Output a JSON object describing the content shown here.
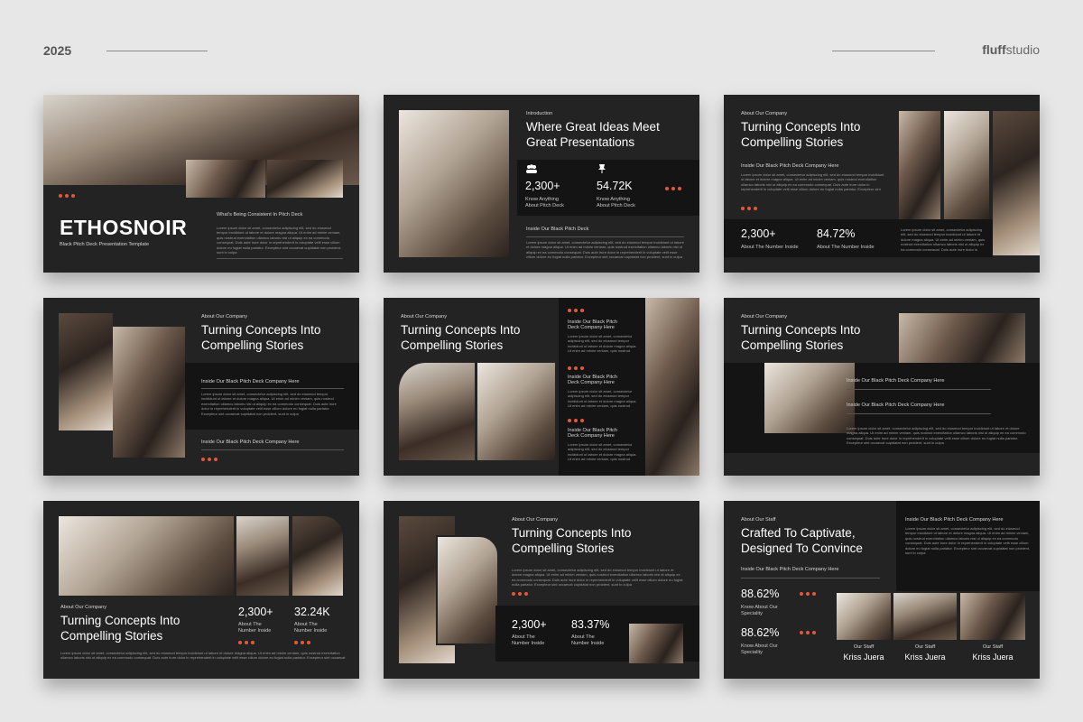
{
  "header": {
    "year": "2025",
    "brand_bold": "fluff",
    "brand_rest": "studio"
  },
  "lorem": "Lorem ipsum dolor sit amet, consectetur adipiscing elit, sed do eiusmod tempor incididunt ut labore et dolore magna aliqua. Ut enim ad minim veniam, quis nostrud exercitation ullamco laboris nisi ut aliquip ex ea commodo consequat. Duis aute irure dolor in reprehenderit in voluptate velit esse cillum dolore eu fugiat nulla pariatur. Excepteur sint occaecat cupidatat non proident, sunt in culpa",
  "s1": {
    "brand": "ETHOSNOIR",
    "subtitle": "Black Pitch Deck Presentation Template",
    "heading": "What's Being Consistent In Pitch Deck"
  },
  "s2": {
    "kicker": "Introduction",
    "title_1": "Where Great Ideas Meet",
    "title_2": "Great Presentations",
    "stat1_num": "2,300+",
    "stat1_l1": "Know Anything",
    "stat1_l2": "About Pitch Deck",
    "stat2_num": "54.72K",
    "stat2_l1": "Know Anything",
    "stat2_l2": "About Pitch Deck",
    "sub": "Inside Our Black Pitch Deck",
    "icon1": "users-icon",
    "icon2": "pin-icon"
  },
  "s3": {
    "kicker": "About Our Company",
    "title_1": "Turning Concepts Into",
    "title_2": "Compelling Stories",
    "sub": "Inside Our Black Pitch Deck Company Here",
    "stat1_num": "2,300+",
    "stat1_lbl": "About The Number Inside",
    "stat2_num": "84.72%",
    "stat2_lbl": "About The Number Inside"
  },
  "s4": {
    "kicker": "About Our Company",
    "title_1": "Turning Concepts Into",
    "title_2": "Compelling Stories",
    "sub1": "Inside Our Black Pitch Deck Company Here",
    "sub2": "Inside Our Black Pitch Deck Company Here"
  },
  "s5": {
    "kicker": "About Our Company",
    "title_1": "Turning Concepts Into",
    "title_2": "Compelling Stories",
    "item_l1": "Inside Our Black Pitch",
    "item_l2": "Deck Company Here"
  },
  "s6": {
    "kicker": "About Our Company",
    "title_1": "Turning Concepts Into",
    "title_2": "Compelling Stories",
    "sub1": "Inside Our Black Pitch Deck Company Here",
    "sub2": "Inside Our Black Pitch Deck Company Here"
  },
  "s7": {
    "kicker": "About Our Company",
    "title_1": "Turning Concepts Into",
    "title_2": "Compelling Stories",
    "stat1_num": "2,300+",
    "stat1_l1": "About The",
    "stat1_l2": "Number Inside",
    "stat2_num": "32.24K",
    "stat2_l1": "About The",
    "stat2_l2": "Number Inside"
  },
  "s8": {
    "kicker": "About Our Company",
    "title_1": "Turning Concepts Into",
    "title_2": "Compelling Stories",
    "stat1_num": "2,300+",
    "stat1_l1": "About The",
    "stat1_l2": "Number Inside",
    "stat2_num": "83.37%",
    "stat2_l1": "About The",
    "stat2_l2": "Number Inside"
  },
  "s9": {
    "kicker": "About Our Staff",
    "title_1": "Crafted To Captivate,",
    "title_2": "Designed To Convince",
    "sub_left": "Inside Our Black Pitch Deck Company Here",
    "sub_right": "Inside Our Black Pitch Deck Company Here",
    "stat1_num": "88.62%",
    "stat1_l1": "Know About Our",
    "stat1_l2": "Speciality",
    "stat2_num": "88.62%",
    "stat2_l1": "Know About Our",
    "stat2_l2": "Speciality",
    "staff_role": "Our Staff",
    "staff_name": "Kriss Juera"
  },
  "colors": {
    "background": "#e7e7e7",
    "slide": "#232323",
    "panel": "#141414",
    "accent": "#e4583a"
  }
}
